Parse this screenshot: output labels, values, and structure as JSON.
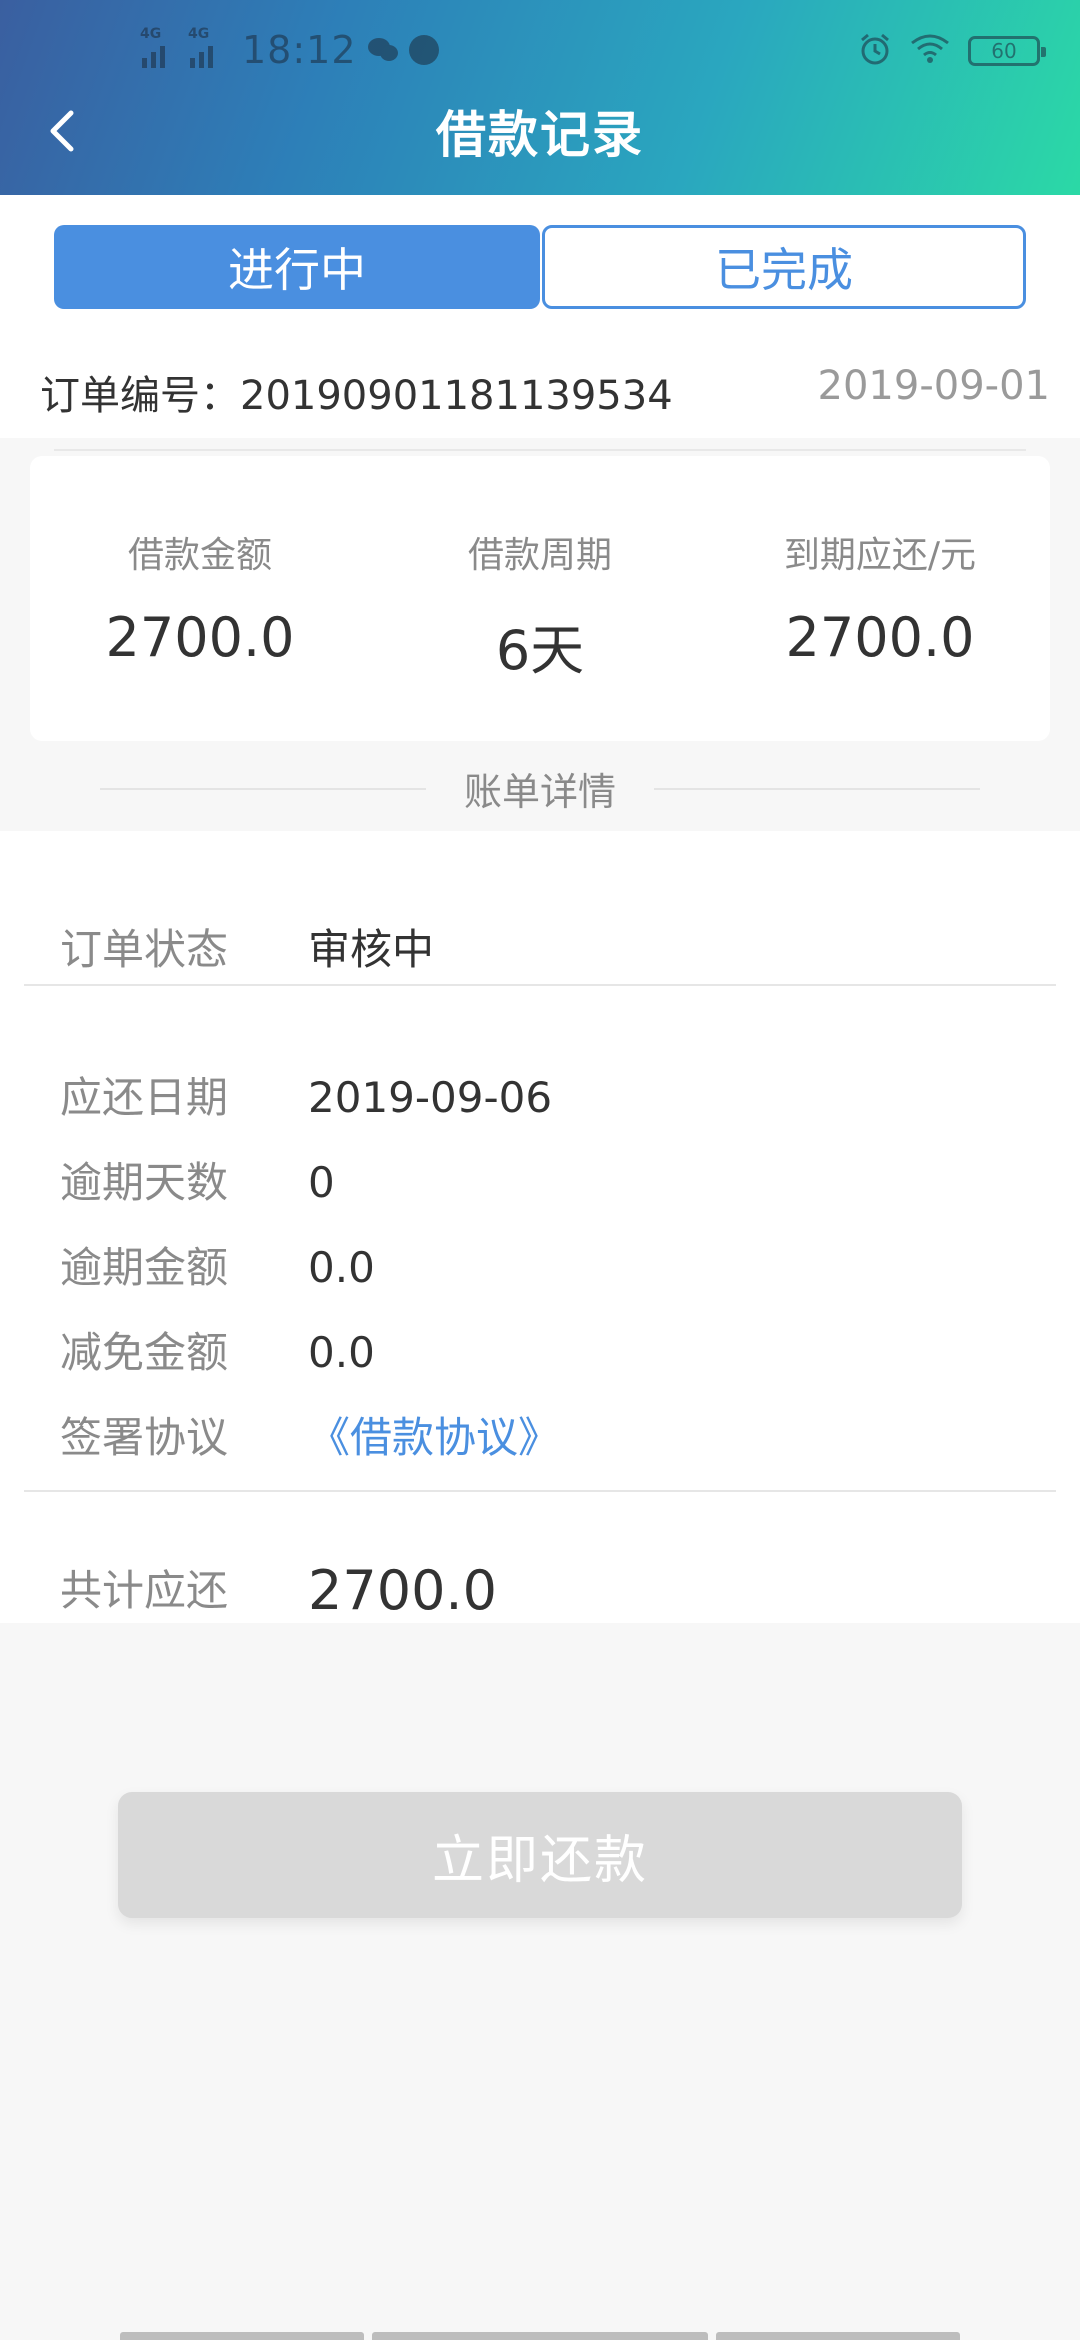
{
  "status_bar": {
    "network_1": "4G",
    "network_2": "4G",
    "time": "18:12",
    "battery": "60"
  },
  "nav": {
    "title": "借款记录"
  },
  "tabs": [
    {
      "label": "进行中",
      "active": true
    },
    {
      "label": "已完成",
      "active": false
    }
  ],
  "order": {
    "label": "订单编号：",
    "number": "20190901181139534",
    "date": "2019-09-01"
  },
  "summary": [
    {
      "label": "借款金额",
      "value": "2700.0"
    },
    {
      "label": "借款周期",
      "value": "6天"
    },
    {
      "label": "到期应还/元",
      "value": "2700.0"
    }
  ],
  "bill": {
    "title": "账单详情",
    "status_label": "订单状态",
    "status_value": "审核中",
    "rows": [
      {
        "label": "应还日期",
        "value": "2019-09-06"
      },
      {
        "label": "逾期天数",
        "value": "0"
      },
      {
        "label": "逾期金额",
        "value": "0.0"
      },
      {
        "label": "减免金额",
        "value": "0.0"
      },
      {
        "label": "签署协议",
        "value": "《借款协议》"
      }
    ],
    "total_label": "共计应还",
    "total_value": "2700.0"
  },
  "actions": {
    "repay_label": "立即还款"
  },
  "colors": {
    "accent": "#4a8fe0",
    "header_start": "#3a5fa0",
    "header_end": "#2bd9a6",
    "disabled_button": "#d9d9d9"
  }
}
